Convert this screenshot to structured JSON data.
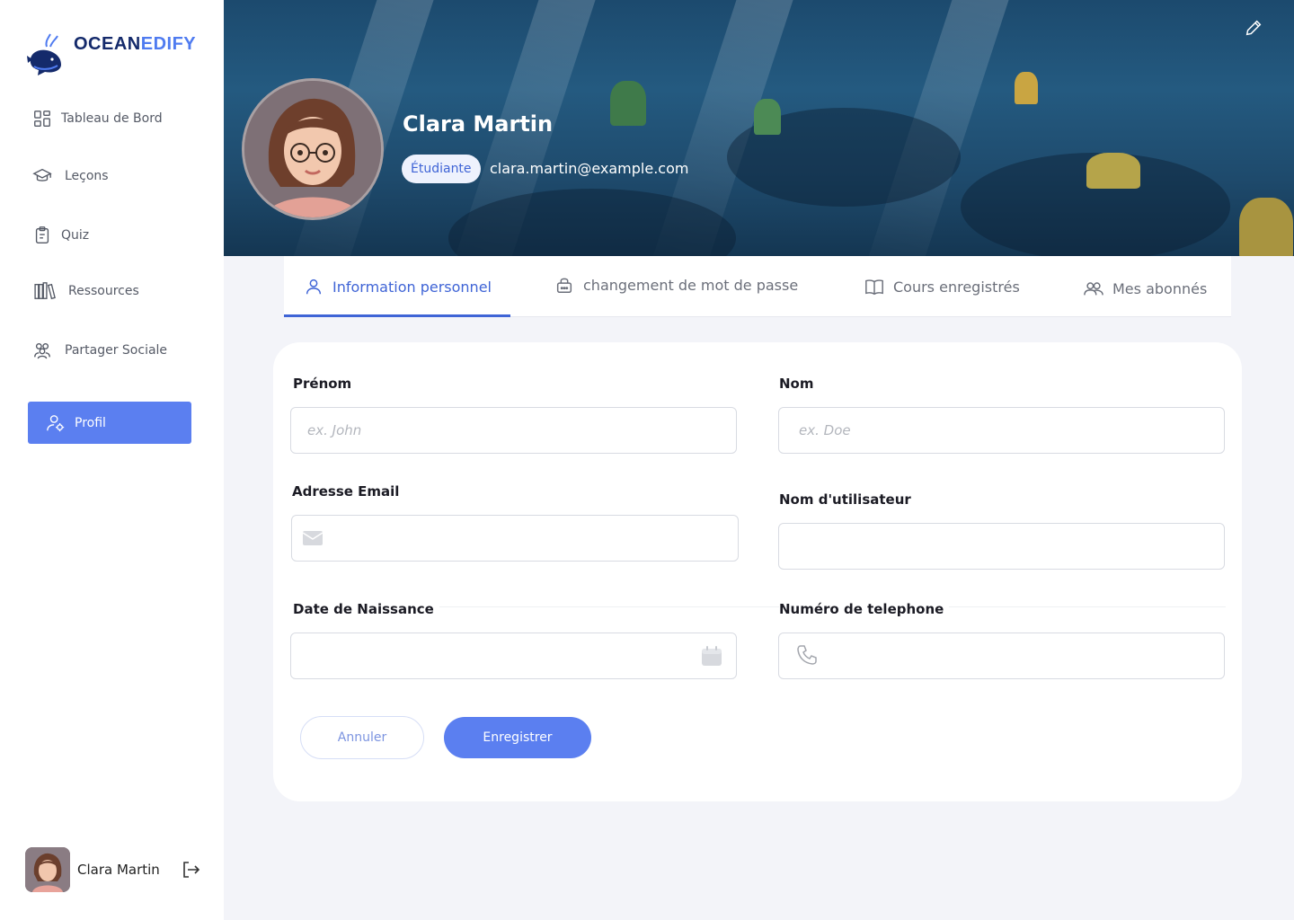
{
  "app": {
    "logo_part1": "OCEAN",
    "logo_part2": "EDIFY"
  },
  "sidebar": {
    "items": [
      {
        "label": "Tableau de Bord",
        "icon": "dashboard-grid-icon"
      },
      {
        "label": "Leçons",
        "icon": "graduation-cap-icon"
      },
      {
        "label": "Quiz",
        "icon": "clipboard-icon"
      },
      {
        "label": "Ressources",
        "icon": "books-icon"
      },
      {
        "label": "Partager Sociale",
        "icon": "people-group-icon"
      }
    ],
    "active": {
      "label": "Profil",
      "icon": "user-gear-icon"
    },
    "user": {
      "name": "Clara Martin"
    }
  },
  "profile": {
    "name": "Clara Martin",
    "role": "Étudiante",
    "email": "clara.martin@example.com"
  },
  "tabs": [
    {
      "label": "Information personnel",
      "icon": "user-icon"
    },
    {
      "label": "changement de mot de passe",
      "icon": "lock-icon"
    },
    {
      "label": "Cours enregistrés",
      "icon": "open-book-icon"
    },
    {
      "label": "Mes abonnés",
      "icon": "users-icon"
    }
  ],
  "form": {
    "firstname": {
      "label": "Prénom",
      "placeholder": "ex. John",
      "value": ""
    },
    "lastname": {
      "label": "Nom",
      "placeholder": "ex. Doe",
      "value": ""
    },
    "email": {
      "label": "Adresse Email",
      "placeholder": "",
      "value": ""
    },
    "username": {
      "label": "Nom d'utilisateur",
      "placeholder": "",
      "value": ""
    },
    "birthdate": {
      "label": "Date de Naissance",
      "placeholder": "",
      "value": ""
    },
    "phone": {
      "label": "Numéro de telephone",
      "placeholder": "",
      "value": ""
    },
    "cancel_label": "Annuler",
    "save_label": "Enregistrer"
  },
  "colors": {
    "accent": "#5b7ff0",
    "accent_text": "#3f64d6",
    "page_bg": "#f3f4f9",
    "banner": "#1c4a6e"
  }
}
